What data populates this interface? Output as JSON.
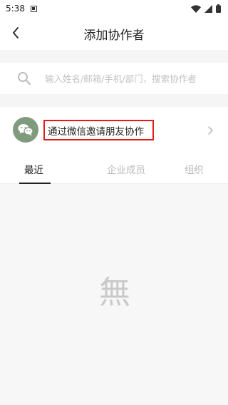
{
  "status_bar": {
    "time": "5:38",
    "icons": [
      "notification-icon",
      "wifi-icon",
      "signal-icon",
      "battery-icon"
    ]
  },
  "header": {
    "title": "添加协作者",
    "back_icon": "chevron-left-icon"
  },
  "search": {
    "placeholder": "输入姓名/邮箱/手机/部门，搜索协作者",
    "value": ""
  },
  "invite": {
    "label": "通过微信邀请朋友协作",
    "avatar_icon": "wechat-icon",
    "chevron_icon": "chevron-right-icon",
    "highlight_color": "#e21b1b",
    "avatar_color": "#7f9a7d"
  },
  "tabs": [
    {
      "label": "最近",
      "active": true
    },
    {
      "label": "企业成员",
      "active": false
    },
    {
      "label": "组织",
      "active": false
    }
  ],
  "empty_state": {
    "glyph": "無"
  }
}
